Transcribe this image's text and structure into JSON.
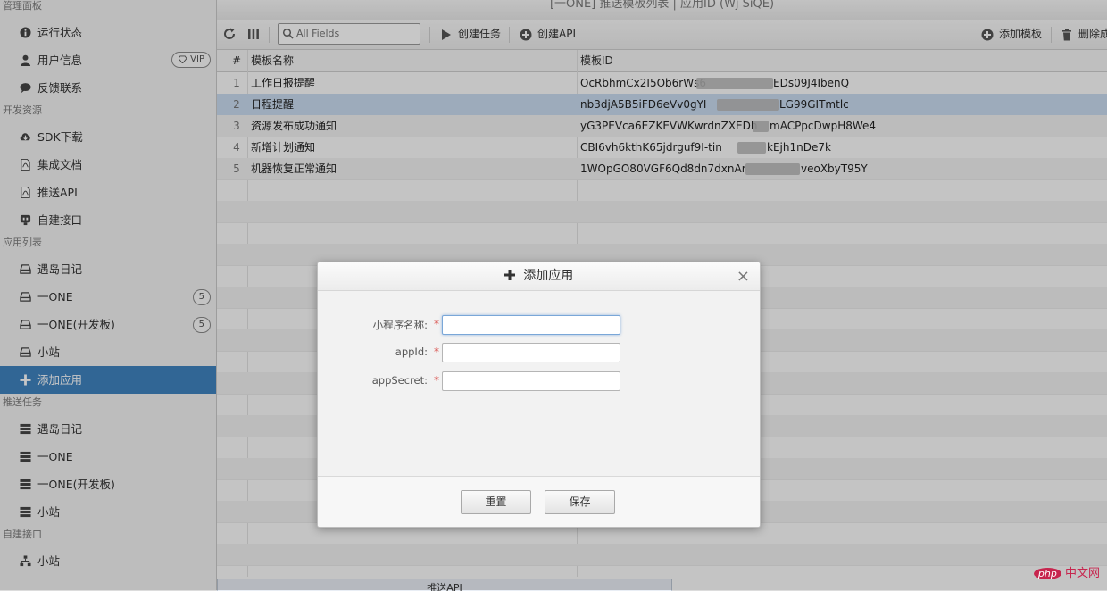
{
  "window_title": "[一ONE] 推送模板列表 | 应用ID (Wj          SiQE)",
  "sidebar": {
    "sections": [
      {
        "heading": "管理面板",
        "items": [
          {
            "label": "运行状态",
            "icon": "info-icon"
          },
          {
            "label": "用户信息",
            "icon": "user-icon",
            "badge": "VIP"
          },
          {
            "label": "反馈联系",
            "icon": "chat-icon"
          }
        ]
      },
      {
        "heading": "开发资源",
        "items": [
          {
            "label": "SDK下载",
            "icon": "cloud-download-icon"
          },
          {
            "label": "集成文档",
            "icon": "file-pdf-icon"
          },
          {
            "label": "推送API",
            "icon": "file-pdf-icon"
          },
          {
            "label": "自建接口",
            "icon": "plug-icon"
          }
        ]
      },
      {
        "heading": "应用列表",
        "items": [
          {
            "label": "遇岛日记",
            "icon": "hdd-icon"
          },
          {
            "label": "一ONE",
            "icon": "hdd-icon",
            "badge": "5"
          },
          {
            "label": "一ONE(开发板)",
            "icon": "hdd-icon",
            "badge": "5"
          },
          {
            "label": "小站",
            "icon": "hdd-icon"
          },
          {
            "label": "添加应用",
            "icon": "plus-icon",
            "active": true
          }
        ]
      },
      {
        "heading": "推送任务",
        "items": [
          {
            "label": "遇岛日记",
            "icon": "server-icon"
          },
          {
            "label": "一ONE",
            "icon": "server-icon"
          },
          {
            "label": "一ONE(开发板)",
            "icon": "server-icon"
          },
          {
            "label": "小站",
            "icon": "server-icon"
          }
        ]
      },
      {
        "heading": "自建接口",
        "items": [
          {
            "label": "小站",
            "icon": "sitemap-icon"
          }
        ]
      }
    ]
  },
  "toolbar": {
    "search_placeholder": "All Fields",
    "create_task": "创建任务",
    "create_api": "创建API",
    "add_template": "添加模板",
    "delete": "删除成"
  },
  "grid": {
    "columns": [
      "#",
      "模板名称",
      "模板ID"
    ],
    "rows": [
      {
        "num": "1",
        "name": "工作日报提醒",
        "id_start": "OcRbhmCx2I5Ob6rWs6",
        "id_end": "EDs09J4IbenQ"
      },
      {
        "num": "2",
        "name": "日程提醒",
        "id_start": "nb3djA5B5iFD6eVv0gYI",
        "id_end": "LG99GITmtlc",
        "selected": true
      },
      {
        "num": "3",
        "name": "资源发布成功通知",
        "id_start": "yG3PEVca6EZKEVWKwrdnZXEDh",
        "id_end": "mACPpcDwpH8We4"
      },
      {
        "num": "4",
        "name": "新增计划通知",
        "id_start": "CBI6vh6kthK65jdrguf9I-tin",
        "id_end": "kEjh1nDe7k"
      },
      {
        "num": "5",
        "name": "机器恢复正常通知",
        "id_start": "1WOpGO80VGF6Qd8dn7dxnArdp_2",
        "id_end": "veoXbyT95Y"
      }
    ]
  },
  "bottom_tab": "推送API",
  "dialog": {
    "title": "添加应用",
    "close": "×",
    "fields": [
      {
        "label": "小程序名称:",
        "value": ""
      },
      {
        "label": "appId:",
        "value": ""
      },
      {
        "label": "appSecret:",
        "value": ""
      }
    ],
    "required_mark": "*",
    "reset": "重置",
    "save": "保存"
  },
  "watermark": {
    "badge": "php",
    "text": "中文网"
  },
  "colors": {
    "accent": "#3f83bf",
    "selected_row": "#c9dcf0",
    "required": "#d9534f"
  }
}
